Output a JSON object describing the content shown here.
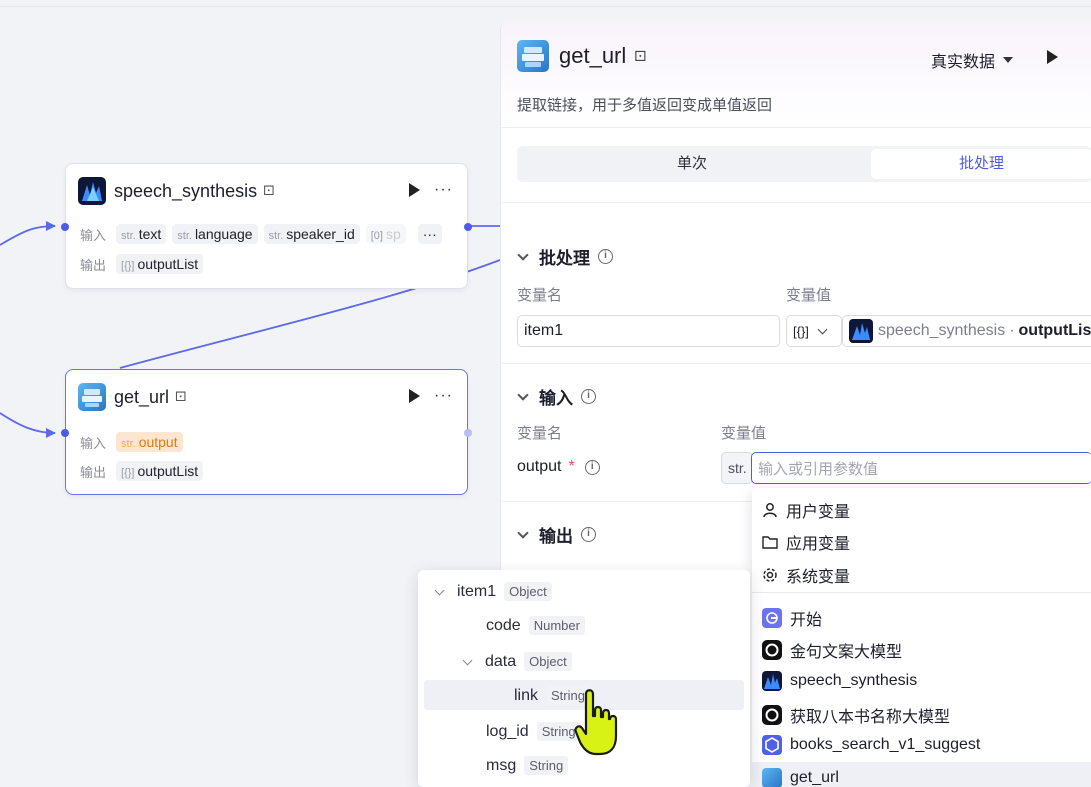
{
  "canvas": {
    "speech_node": {
      "title": "speech_synthesis",
      "input_label": "输入",
      "output_label": "输出",
      "inputs": [
        {
          "type": "str.",
          "name": "text"
        },
        {
          "type": "str.",
          "name": "language"
        },
        {
          "type": "str.",
          "name": "speaker_id"
        },
        {
          "type": "[0]",
          "name": "sp"
        }
      ],
      "more_inputs": "···",
      "output": {
        "type": "[{}]",
        "name": "outputList"
      }
    },
    "url_node": {
      "title": "get_url",
      "input_label": "输入",
      "output_label": "输出",
      "input": {
        "type": "str.",
        "name": "output"
      },
      "output": {
        "type": "[{}]",
        "name": "outputList"
      }
    }
  },
  "panel": {
    "title": "get_url",
    "description": "提取链接，用于多值返回变成单值返回",
    "data_mode": "真实数据",
    "tabs": [
      "单次",
      "批处理"
    ],
    "active_tab": "批处理",
    "batch": {
      "section_title": "批处理",
      "col_name": "变量名",
      "col_value": "变量值",
      "var_name": "item1",
      "var_type": "[{}]",
      "ref_node": "speech_synthesis",
      "ref_sep": "·",
      "ref_field": "outputList"
    },
    "input": {
      "section_title": "输入",
      "col_name": "变量名",
      "col_value": "变量值",
      "param_name": "output",
      "required_mark": "*",
      "param_type": "str.",
      "placeholder": "输入或引用参数值"
    },
    "output": {
      "section_title": "输出"
    }
  },
  "dropdown": {
    "groups": [
      "用户变量",
      "应用变量",
      "系统变量"
    ],
    "nodes": [
      "开始",
      "金句文案大模型",
      "speech_synthesis",
      "获取八本书名称大模型",
      "books_search_v1_suggest",
      "get_url"
    ]
  },
  "tree": {
    "items": [
      {
        "name": "item1",
        "type": "Object"
      },
      {
        "name": "code",
        "type": "Number"
      },
      {
        "name": "data",
        "type": "Object"
      },
      {
        "name": "link",
        "type": "String"
      },
      {
        "name": "log_id",
        "type": "String"
      },
      {
        "name": "msg",
        "type": "String"
      }
    ]
  },
  "colors": {
    "accent": "#4d5be6",
    "orange_chip": "#e07a12",
    "edge": "#5b6ae8"
  }
}
